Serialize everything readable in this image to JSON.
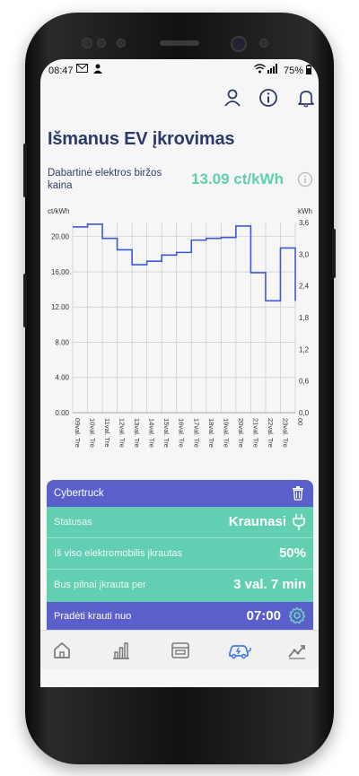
{
  "status_bar": {
    "time": "08:47",
    "battery": "75%"
  },
  "header": {
    "title": "Išmanus EV įkrovimas",
    "icons": [
      "user-icon",
      "info-icon",
      "bell-icon"
    ]
  },
  "price": {
    "label": "Dabartinė elektros biržos kaina",
    "value": "13.09 ct/kWh"
  },
  "chart_data": {
    "type": "line",
    "left_unit": "ct/kWh",
    "right_unit": "kWh",
    "left_ticks": [
      "20.00",
      "16.00",
      "12.00",
      "8.00",
      "4.00",
      "0.00"
    ],
    "right_ticks": [
      "3,6",
      "3,0",
      "2,4",
      "1,8",
      "1,2",
      "0,6",
      "0,0"
    ],
    "ylim": [
      0,
      21.6
    ],
    "categories": [
      "09val. Tre",
      "10val. Tre",
      "11val. Tre",
      "12val. Tre",
      "13val. Tre",
      "14val. Tre",
      "15val. Tre",
      "16val. Tre",
      "17val. Tre",
      "18val. Tre",
      "19val. Tre",
      "20val. Tre",
      "21val. Tre",
      "22val. Tre",
      "23val. Tre",
      "00"
    ],
    "series": [
      {
        "values": [
          21.1,
          21.4,
          19.8,
          18.5,
          16.8,
          17.2,
          17.9,
          18.2,
          19.6,
          19.8,
          19.9,
          21.2,
          15.9,
          12.7,
          18.7,
          12.7
        ],
        "color": "#3f58d6",
        "step": true
      }
    ],
    "grid": true
  },
  "card": {
    "vehicle_name": "Cybertruck",
    "rows": [
      {
        "label": "Statusas",
        "value": "Kraunasi"
      },
      {
        "label": "Iš viso elektromobilis įkrautas",
        "value": "50%"
      },
      {
        "label": "Bus pilnai įkrauta per",
        "value": "3 val. 7 min"
      }
    ],
    "footer": {
      "label": "Pradėti krauti nuo",
      "value": "07:00"
    },
    "colors": {
      "header": "#5a5fc9",
      "body": "#62ceb2"
    }
  },
  "nav": {
    "items": [
      "home-icon",
      "bar-chart-icon",
      "wallet-icon",
      "ev-car-icon",
      "trend-icon"
    ],
    "active": "ev-car-icon",
    "active_color": "#3e7be0"
  }
}
